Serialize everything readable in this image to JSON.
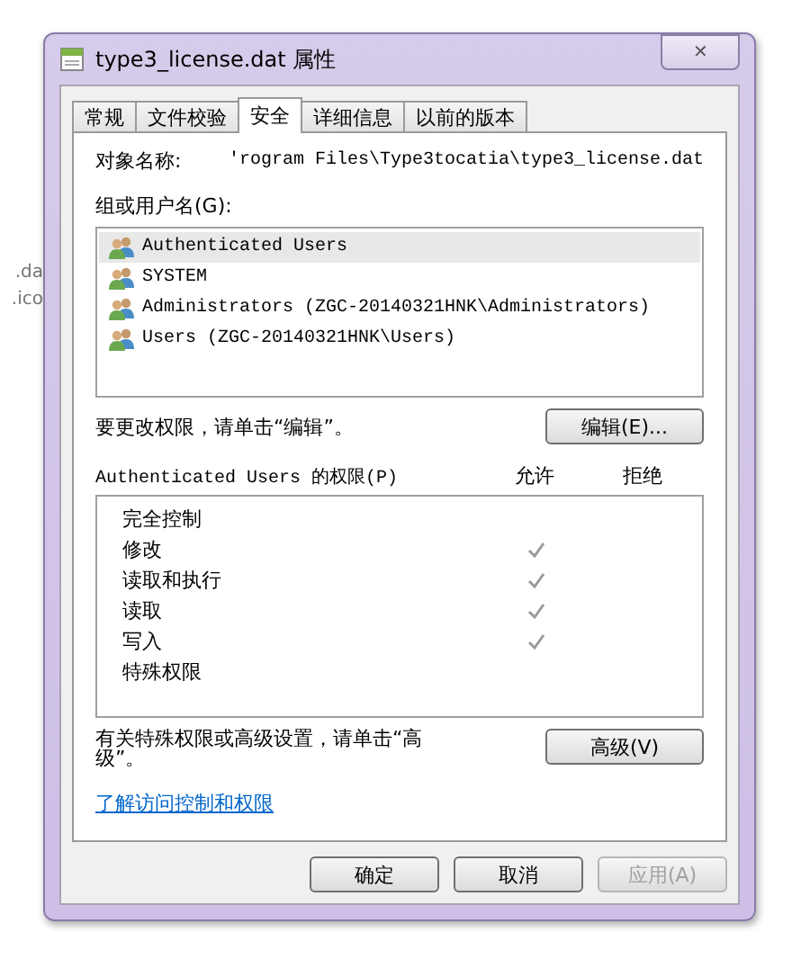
{
  "background_fragments": [
    ".da",
    ".ico"
  ],
  "window": {
    "title": "type3_license.dat 属性",
    "close": "✕"
  },
  "tabs": [
    {
      "label": "常规",
      "selected": false
    },
    {
      "label": "文件校验",
      "selected": false
    },
    {
      "label": "安全",
      "selected": true
    },
    {
      "label": "详细信息",
      "selected": false
    },
    {
      "label": "以前的版本",
      "selected": false
    }
  ],
  "object_name": {
    "label": "对象名称:",
    "value": "'rogram Files\\Type3tocatia\\type3_license.dat"
  },
  "groups": {
    "label": "组或用户名(G):",
    "items": [
      {
        "name": "Authenticated Users",
        "selected": true
      },
      {
        "name": "SYSTEM",
        "selected": false
      },
      {
        "name": "Administrators (ZGC-20140321HNK\\Administrators)",
        "selected": false
      },
      {
        "name": "Users (ZGC-20140321HNK\\Users)",
        "selected": false
      }
    ]
  },
  "edit_hint": "要更改权限，请单击“编辑”。",
  "edit_button": "编辑(E)...",
  "permissions": {
    "label": "Authenticated Users 的权限(P)",
    "allow_header": "允许",
    "deny_header": "拒绝",
    "rows": [
      {
        "name": "完全控制",
        "allow": false,
        "deny": false
      },
      {
        "name": "修改",
        "allow": true,
        "deny": false
      },
      {
        "name": "读取和执行",
        "allow": true,
        "deny": false
      },
      {
        "name": "读取",
        "allow": true,
        "deny": false
      },
      {
        "name": "写入",
        "allow": true,
        "deny": false
      },
      {
        "name": "特殊权限",
        "allow": false,
        "deny": false
      }
    ]
  },
  "advanced_hint": "有关特殊权限或高级设置，请单击“高级”。",
  "advanced_button": "高级(V)",
  "link": "了解访问控制和权限",
  "buttons": [
    {
      "label": "确定",
      "disabled": false
    },
    {
      "label": "取消",
      "disabled": false
    },
    {
      "label": "应用(A)",
      "disabled": true
    }
  ]
}
